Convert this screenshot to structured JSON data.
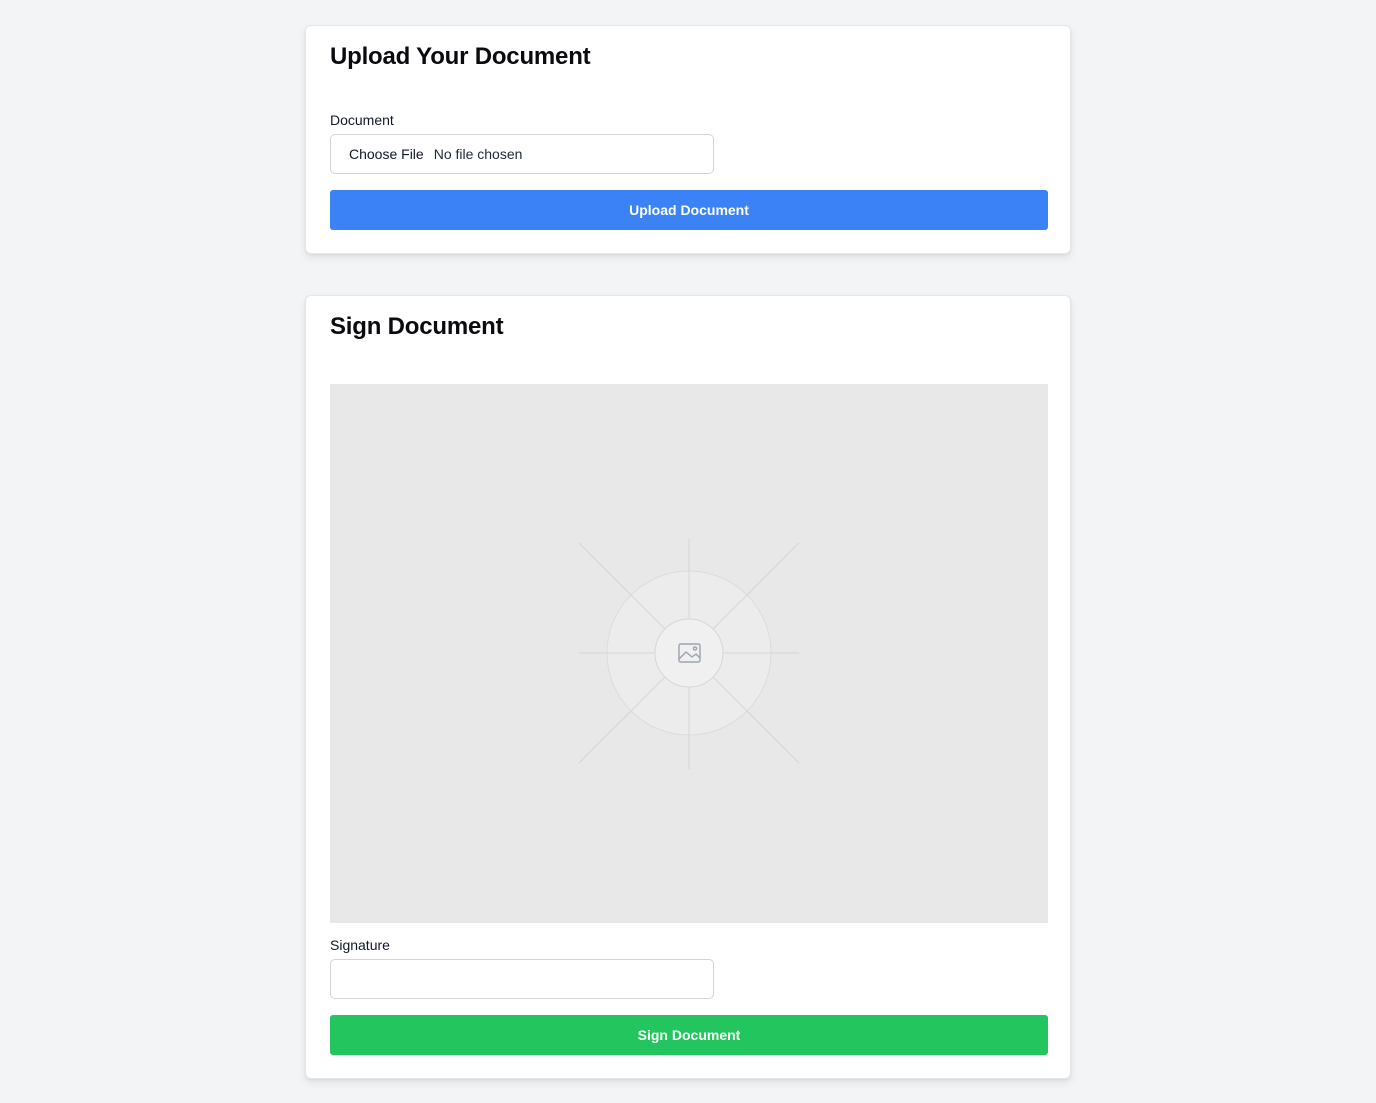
{
  "upload_section": {
    "title": "Upload Your Document",
    "document_label": "Document",
    "file_button_label": "Choose File",
    "file_status": "No file chosen",
    "upload_button_label": "Upload Document"
  },
  "sign_section": {
    "title": "Sign Document",
    "preview_icon": "image-placeholder-icon",
    "signature_label": "Signature",
    "signature_value": "",
    "signature_placeholder": "",
    "sign_button_label": "Sign Document"
  },
  "colors": {
    "page_background": "#f3f4f6",
    "upload_button": "#3b82f6",
    "sign_button": "#22c55e",
    "preview_background": "#e8e8e8"
  }
}
